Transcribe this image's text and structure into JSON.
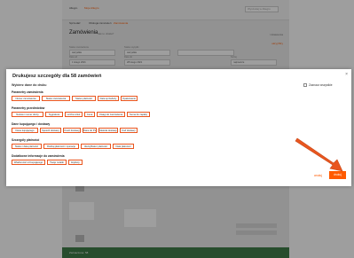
{
  "background_page": {
    "nav": [
      "Allegro",
      "Moje Allegro",
      "Sprzedaż",
      "Obsługa zamówień",
      "Zamówienia"
    ],
    "search_placeholder": "Wyszukaj w Allegro",
    "page_title": "Zamówienia",
    "page_subtitle": "Jak to działa?",
    "top_right_link": "Ustawienia",
    "filters": [
      {
        "label": "Status zamówienia",
        "value": "wszystkie"
      },
      {
        "label": "Status wysyłki",
        "value": "wszystkie"
      },
      {
        "label": "szukaj",
        "value": ""
      },
      {
        "label": "Data od",
        "value": "1 lutego 2021"
      },
      {
        "label": "Data do",
        "value": "28 lutego 2021"
      },
      {
        "label": "Sortuj",
        "value": "najnowsze"
      }
    ],
    "filter_link": "ukryj filtry",
    "bottom_bar": "Zaznaczone: 58"
  },
  "modal": {
    "title": "Drukujesz szczegóły dla 58 zamówień",
    "select_section": "Wybierz dane do druku",
    "check_all": "Zaznacz wszystkie",
    "sections": [
      {
        "title": "Parametry zamówienia",
        "options": [
          "Numer zamówienia",
          "Status zamówienia",
          "Status płatności",
          "Data sprzedaży",
          "Opakowanie"
        ]
      },
      {
        "title": "Parametry przedmiotów",
        "options": [
          "Nazwa i numer oferty",
          "Sygnatura",
          "Liczba sztuk",
          "Cena",
          "Uwagi do zamówienia",
          "Suma do zapłaty"
        ]
      },
      {
        "title": "Dane kupującego i dostawy",
        "options": [
          "Dane kupującego",
          "Sposób dostawy",
          "Koszt dostawy",
          "Dane do FV",
          "Metoda dostawy",
          "Kod dostawy"
        ]
      },
      {
        "title": "Szczegóły płatności",
        "options": [
          "Status i data płatności",
          "Rodzaj płatności i operacje",
          "Identyfikator płatności",
          "Data płatności"
        ]
      },
      {
        "title": "Dodatkowe informacje do zamówienia",
        "options": [
          "Wiadomość od kupującego",
          "Twoje notatki",
          "Etykiety"
        ]
      }
    ],
    "cancel_label": "anuluj",
    "print_label": "drukuj"
  },
  "colors": {
    "accent": "#ff5a00",
    "chip_border": "#e9561f",
    "bottom_bar": "#3f7c4a"
  }
}
